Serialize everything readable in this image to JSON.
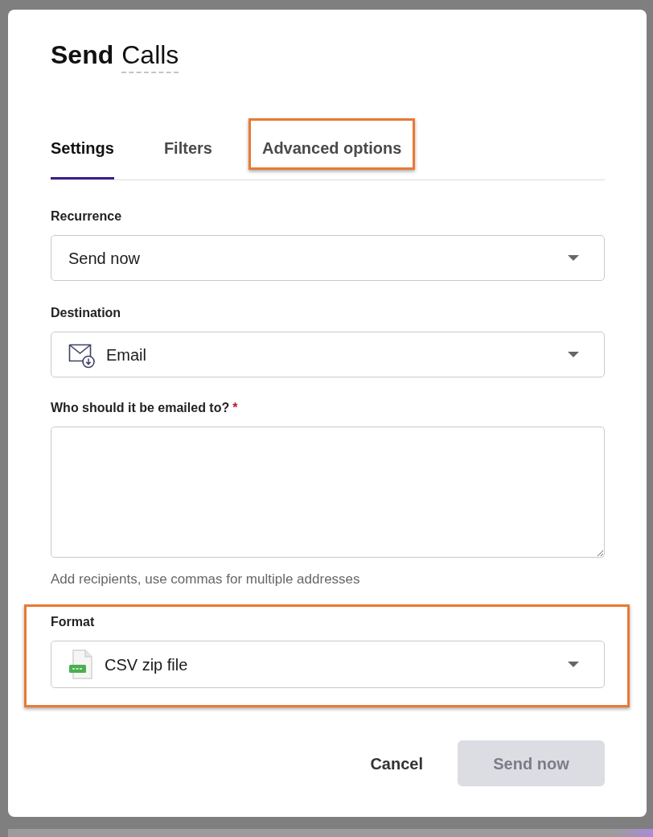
{
  "dialog": {
    "title": {
      "action": "Send",
      "name": "Calls"
    }
  },
  "tabs": [
    {
      "label": "Settings",
      "selected": true,
      "highlighted": false
    },
    {
      "label": "Filters",
      "selected": false,
      "highlighted": false
    },
    {
      "label": "Advanced options",
      "selected": false,
      "highlighted": true
    }
  ],
  "recurrence": {
    "label": "Recurrence",
    "value": "Send now"
  },
  "destination": {
    "label": "Destination",
    "value": "Email"
  },
  "recipients": {
    "label": "Who should it be emailed to?",
    "required_mark": "*",
    "help": "Add recipients, use commas for multiple addresses"
  },
  "format": {
    "label": "Format",
    "value": "CSV zip file",
    "highlighted": true
  },
  "buttons": [
    {
      "label": "Cancel",
      "kind": "secondary",
      "disabled": false
    },
    {
      "label": "Send now",
      "kind": "primary",
      "disabled": true
    }
  ]
}
